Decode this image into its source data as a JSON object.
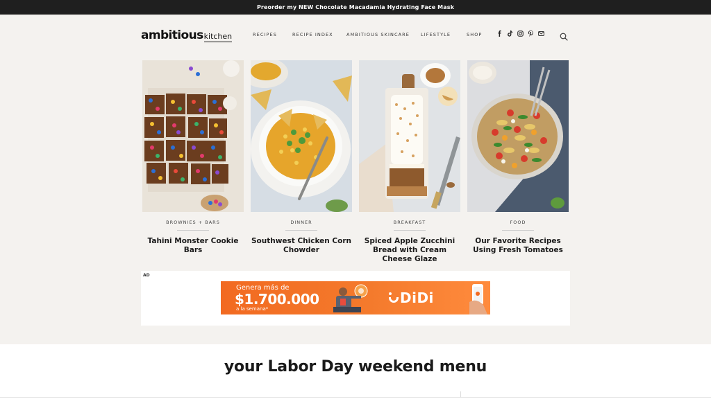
{
  "promo": {
    "text": "Preorder my NEW Chocolate Macadamia Hydrating Face Mask"
  },
  "logo": {
    "main": "ambitious",
    "sub": "kitchen"
  },
  "nav": {
    "items": [
      "RECIPES",
      "RECIPE INDEX",
      "AMBITIOUS SKINCARE",
      "LIFESTYLE",
      "SHOP"
    ]
  },
  "social": {
    "icons": [
      "facebook-icon",
      "tiktok-icon",
      "instagram-icon",
      "pinterest-icon",
      "email-icon"
    ],
    "facebook_glyph": "f"
  },
  "cards": [
    {
      "category": "BROWNIES + BARS",
      "title": "Tahini Monster Cookie Bars"
    },
    {
      "category": "DINNER",
      "title": "Southwest Chicken Corn Chowder"
    },
    {
      "category": "BREAKFAST",
      "title": "Spiced Apple Zucchini Bread with Cream Cheese Glaze"
    },
    {
      "category": "FOOD",
      "title": "Our Favorite Recipes Using Fresh Tomatoes"
    }
  ],
  "ad": {
    "label": "AD",
    "line1": "Genera más de",
    "line2": "$1.700.000",
    "line3": "a la semana*",
    "brand": "DiDi",
    "colors": {
      "accent": "#f26a21"
    }
  },
  "section": {
    "title": "your Labor Day weekend menu"
  },
  "colors": {
    "background": "#f4f2ef",
    "promo_bar": "#1f1f1f"
  }
}
